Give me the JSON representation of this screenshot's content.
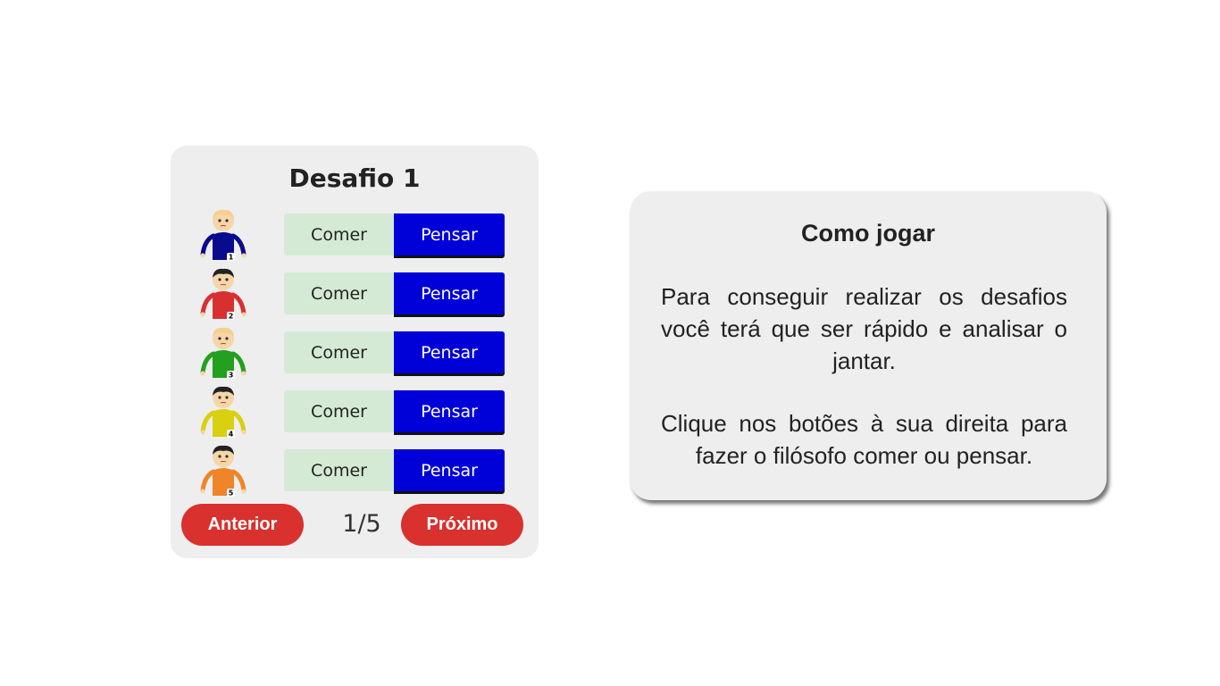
{
  "challenge": {
    "title": "Desafio 1",
    "philosophers": [
      {
        "number": "1",
        "shirt_color": "#0a0a8c",
        "hair_color": "#f5d090",
        "comer_label": "Comer",
        "pensar_label": "Pensar"
      },
      {
        "number": "2",
        "shirt_color": "#d83030",
        "hair_color": "#222222",
        "comer_label": "Comer",
        "pensar_label": "Pensar"
      },
      {
        "number": "3",
        "shirt_color": "#22a01e",
        "hair_color": "#f5d090",
        "comer_label": "Comer",
        "pensar_label": "Pensar"
      },
      {
        "number": "4",
        "shirt_color": "#d8d010",
        "hair_color": "#222222",
        "comer_label": "Comer",
        "pensar_label": "Pensar"
      },
      {
        "number": "5",
        "shirt_color": "#f08428",
        "hair_color": "#222222",
        "comer_label": "Comer",
        "pensar_label": "Pensar"
      }
    ],
    "prev_label": "Anterior",
    "next_label": "Próximo",
    "page_indicator": "1/5"
  },
  "how_to_play": {
    "title": "Como jogar",
    "paragraphs": [
      "Para conseguir realizar os desafios você terá que ser rápido e analisar o jantar.",
      "Clique nos botões à sua direita para fazer o filósofo comer ou pensar."
    ]
  },
  "colors": {
    "pensar_blue": "#0000d9",
    "comer_green": "#d4ead4",
    "nav_red": "#d8312e",
    "card_gray": "#eeeeee",
    "skin": "#f6d6a8"
  }
}
